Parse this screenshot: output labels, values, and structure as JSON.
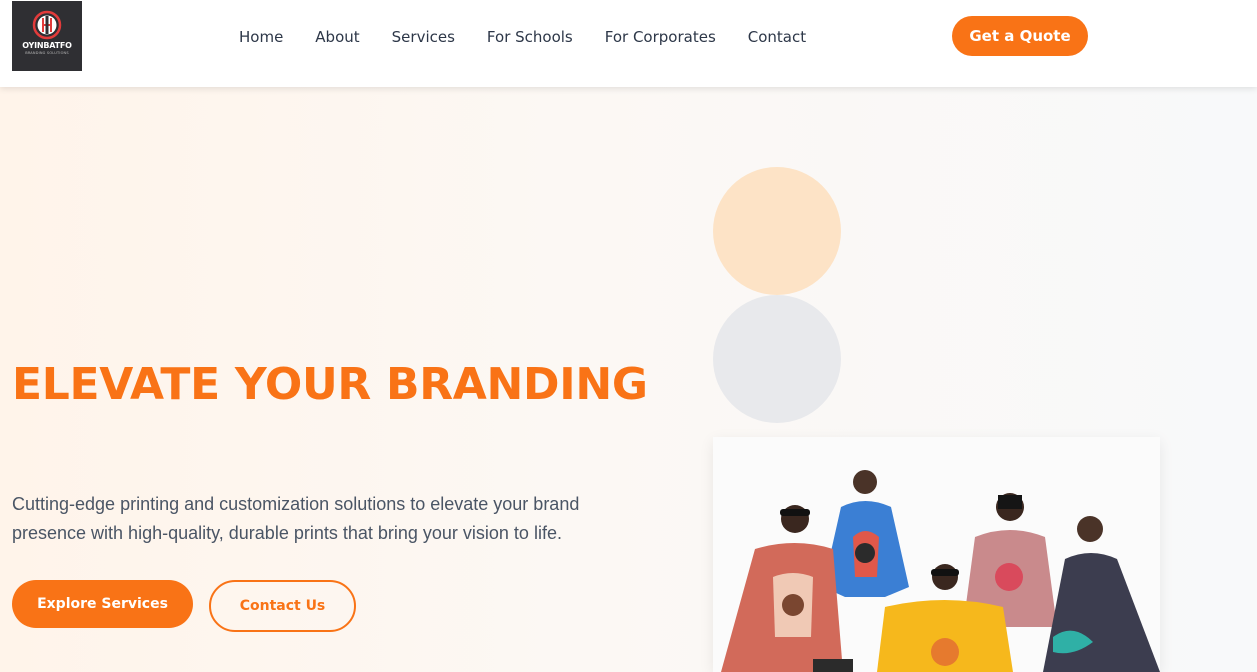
{
  "brand": {
    "name": "OYINBATFO",
    "tagline": "BRANDING SOLUTIONS"
  },
  "nav": {
    "links": [
      "Home",
      "About",
      "Services",
      "For Schools",
      "For Corporates",
      "Contact"
    ],
    "cta_label": "Get a Quote"
  },
  "hero": {
    "title": "ELEVATE YOUR BRANDING",
    "description": "Cutting-edge printing and customization solutions to elevate your brand presence with high-quality, durable prints that bring your vision to life.",
    "primary_button": "Explore Services",
    "secondary_button": "Contact Us"
  },
  "colors": {
    "accent": "#f97316",
    "text": "#2d3748",
    "muted_text": "#4a5565",
    "circle_orange": "#fde3c6",
    "circle_gray": "#e8e9ec"
  },
  "icons": {
    "logo": "brand-logo-icon"
  }
}
